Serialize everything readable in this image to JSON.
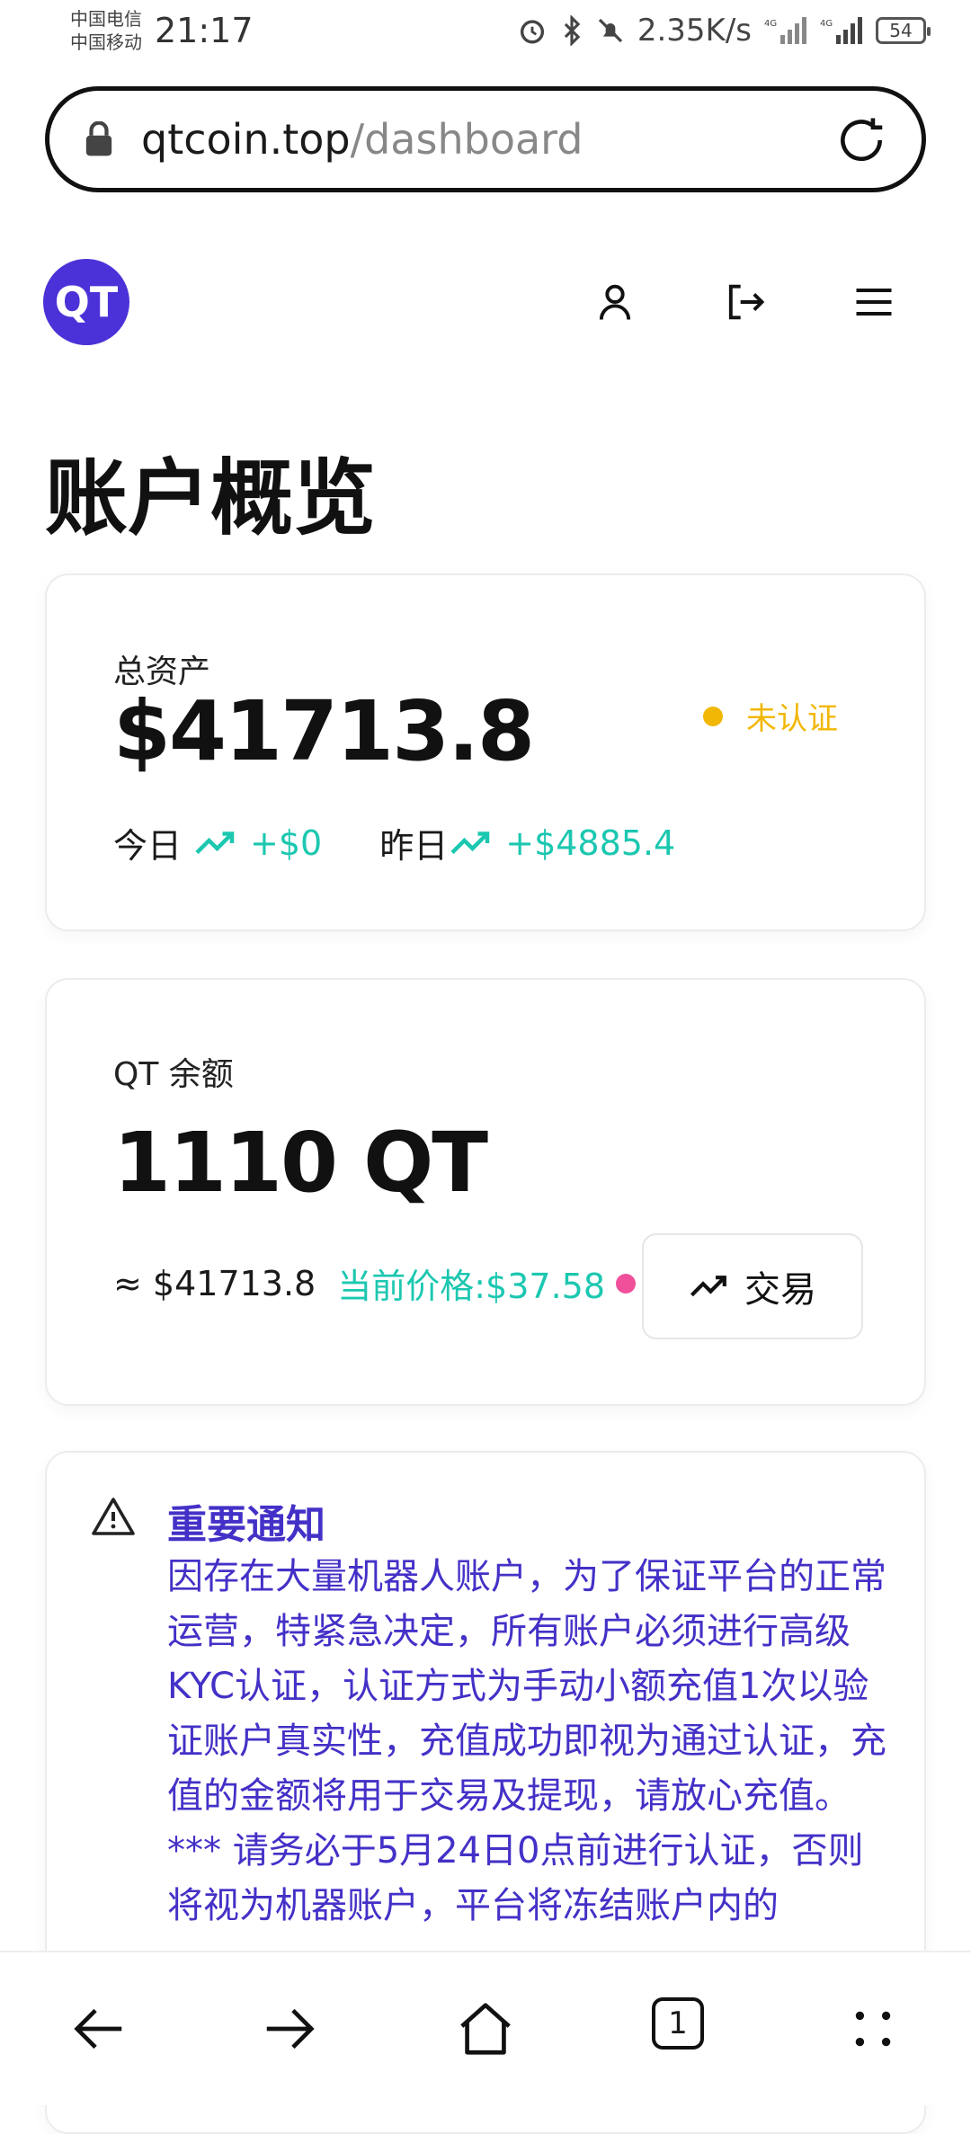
{
  "status_bar": {
    "carrier1": "中国电信",
    "carrier2": "中国移动",
    "time": "21:17",
    "net_speed": "2.35K/s",
    "battery": "54"
  },
  "browser": {
    "url_host": "qtcoin.top",
    "url_path": "/dashboard",
    "tab_count": "1"
  },
  "header": {
    "logo_text": "QT"
  },
  "page": {
    "title": "账户概览"
  },
  "assets_card": {
    "label": "总资产",
    "total": "$41713.8",
    "status": "未认证",
    "status_color": "#f2b705",
    "today_label": "今日",
    "today_change": "+$0",
    "yesterday_label": "昨日",
    "yesterday_change": "+$4885.4"
  },
  "balance_card": {
    "label": "QT 余额",
    "amount": "1110 QT",
    "approx_value": "≈ $41713.8",
    "price_text": "当前价格:$37.58",
    "trade_button": "交易"
  },
  "notice": {
    "title": "重要通知",
    "body": "因存在大量机器人账户，为了保证平台的正常运营，特紧急决定，所有账户必须进行高级KYC认证，认证方式为手动小额充值1次以验证账户真实性，充值成功即视为通过认证，充值的金额将用于交易及提现，请放心充值。",
    "footnote": "*** 请务必于5月24日0点前进行认证，否则将视为机器账户，平台将冻结账户内的"
  },
  "colors": {
    "brand": "#4a32d8",
    "accent_green": "#1cc7b0",
    "notice_text": "#4331c7",
    "pink_dot": "#f0509a"
  },
  "icons": {
    "lock": "lock-icon",
    "reload": "reload-icon",
    "user": "user-icon",
    "logout": "logout-icon",
    "menu": "menu-icon",
    "trend": "trend-up-icon",
    "warning": "warning-icon",
    "back": "back-arrow-icon",
    "forward": "forward-arrow-icon",
    "home": "home-icon",
    "more": "more-icon"
  }
}
